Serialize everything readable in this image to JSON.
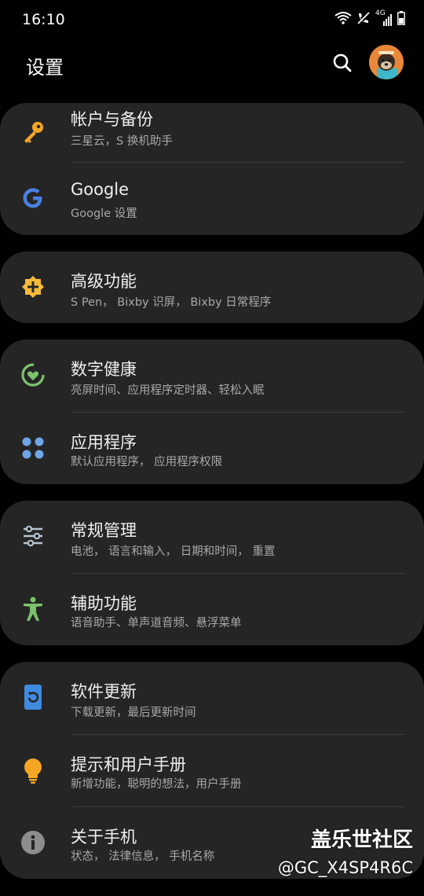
{
  "status": {
    "time": "16:10",
    "network": "4G"
  },
  "header": {
    "title": "设置"
  },
  "items": [
    {
      "title": "帐户与备份",
      "sub": "三星云，S 换机助手"
    },
    {
      "title": "Google",
      "sub": "Google 设置"
    },
    {
      "title": "高级功能",
      "sub": "S Pen， Bixby 识屏， Bixby 日常程序"
    },
    {
      "title": "数字健康",
      "sub": "亮屏时间、应用程序定时器、轻松入眠"
    },
    {
      "title": "应用程序",
      "sub": "默认应用程序， 应用程序权限"
    },
    {
      "title": "常规管理",
      "sub": "电池， 语言和输入， 日期和时间， 重置"
    },
    {
      "title": "辅助功能",
      "sub": "语音助手、单声道音频、悬浮菜单"
    },
    {
      "title": "软件更新",
      "sub": "下载更新，最后更新时间"
    },
    {
      "title": "提示和用户手册",
      "sub": "新增功能，聪明的想法，用户手册"
    },
    {
      "title": "关于手机",
      "sub": "状态， 法律信息， 手机名称"
    }
  ],
  "watermark": {
    "site": "盖乐世社区",
    "user": "@GC_X4SP4R6C"
  },
  "colors": {
    "background": "#000000",
    "card": "#252525",
    "key_icon": "#f5a623",
    "google_blue": "#4a7fe0",
    "advanced_icon": "#f5b93a",
    "wellbeing_icon": "#7cc26b",
    "apps_icon": "#6ea6e8",
    "general_icon": "#b8c4cf",
    "accessibility_icon": "#7cc26b",
    "update_icon": "#3f8be0",
    "tips_icon": "#f5a623",
    "about_icon": "#8d8d8d"
  }
}
